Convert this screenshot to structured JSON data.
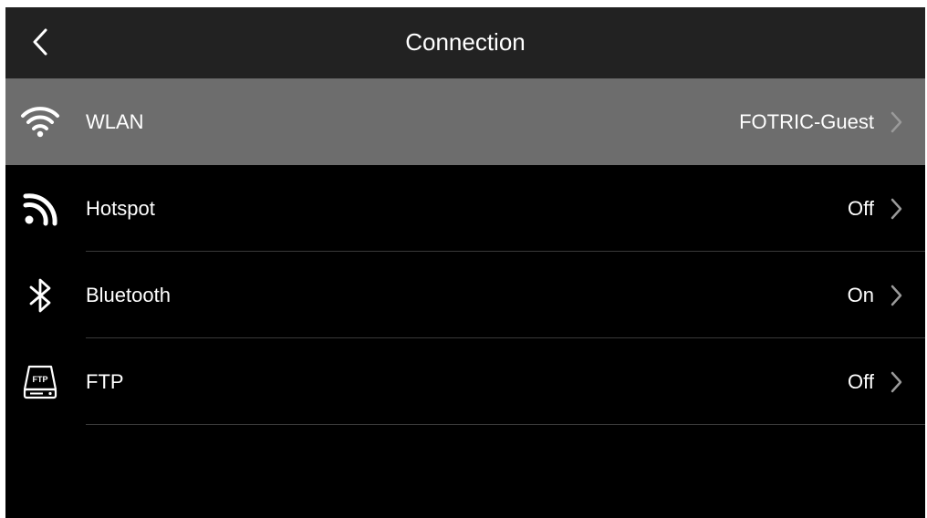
{
  "header": {
    "title": "Connection",
    "back_icon": "chevron-left-icon"
  },
  "items": [
    {
      "label": "WLAN",
      "value": "FOTRIC-Guest",
      "icon": "wifi-icon",
      "selected": true
    },
    {
      "label": "Hotspot",
      "value": "Off",
      "icon": "hotspot-icon",
      "selected": false
    },
    {
      "label": "Bluetooth",
      "value": "On",
      "icon": "bluetooth-icon",
      "selected": false
    },
    {
      "label": "FTP",
      "value": "Off",
      "icon": "ftp-icon",
      "selected": false
    }
  ],
  "colors": {
    "background": "#000000",
    "header": "#222222",
    "selected_row": "#6d6d6d",
    "divider": "#3a3a3a",
    "text": "#ffffff",
    "chevron": "#9a9a9a"
  }
}
